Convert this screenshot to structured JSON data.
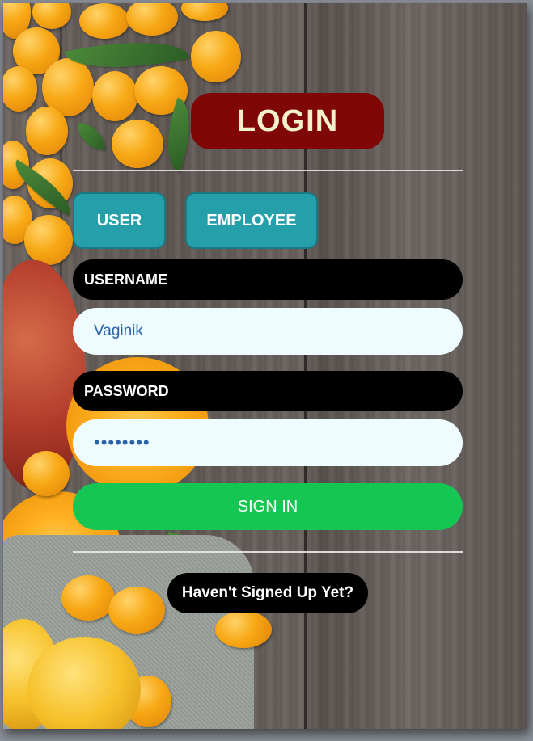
{
  "login": {
    "title": "LOGIN",
    "roles": [
      {
        "label": "USER"
      },
      {
        "label": "EMPLOYEE"
      }
    ],
    "username": {
      "label": "USERNAME",
      "value": "Vaginik"
    },
    "password": {
      "label": "PASSWORD",
      "value": "••••••••"
    },
    "sign_in_label": "SIGN IN",
    "signup_label": "Haven't Signed Up Yet?"
  },
  "colors": {
    "title_bg": "#7f0707",
    "role_bg": "#25a0aa",
    "label_bg": "#000000",
    "input_bg": "#eefcff",
    "signin_bg": "#16c653"
  }
}
